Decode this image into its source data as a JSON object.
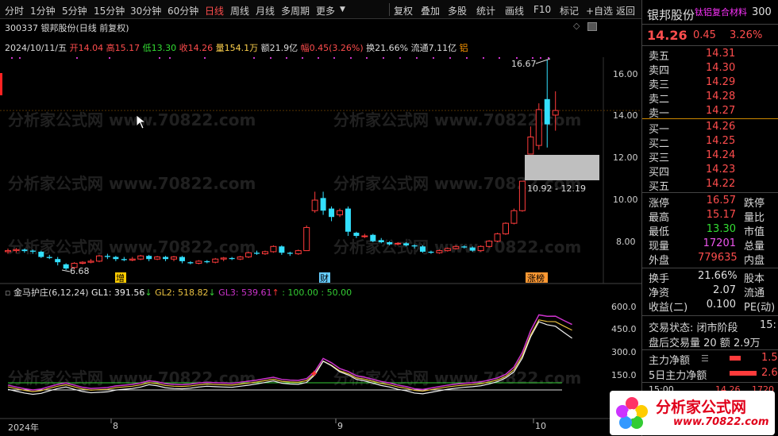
{
  "toolbar": {
    "periods": [
      "分时",
      "1分钟",
      "5分钟",
      "15分钟",
      "30分钟",
      "60分钟",
      "日线",
      "周线",
      "月线",
      "多周期",
      "更多"
    ],
    "active_period": "日线",
    "tools": [
      "复权",
      "叠加",
      "多股",
      "统计",
      "画线",
      "F10",
      "标记",
      "+自选",
      "返回"
    ]
  },
  "chart": {
    "title": "300337 银邦股份(日线 前复权)",
    "date": "2024/10/11/五",
    "quote": {
      "open_label": "开",
      "open": "14.04",
      "high_label": "高",
      "high": "15.17",
      "low_label": "低",
      "low": "13.30",
      "close_label": "收",
      "close": "14.26",
      "vol_label": "量",
      "vol": "154.1万",
      "amt_label": "额",
      "amt": "21.9亿",
      "chg_label": "幅",
      "chg": "0.45(3.26%)",
      "turn_label": "换",
      "turn": "21.66%",
      "float_label": "流通",
      "float": "7.11亿",
      "tag": "铝"
    },
    "price_axis": [
      "16.00",
      "14.00",
      "12.00",
      "10.00",
      "8.00"
    ],
    "annotations": {
      "high_mark": "16.67",
      "low_mark": "6.68",
      "gap_range": "10.92 - 12.19"
    },
    "event_tags": [
      "增",
      "财",
      "涨榜"
    ],
    "time_axis": [
      "2024年",
      "8",
      "9",
      "10"
    ]
  },
  "indicator": {
    "name": "金马护庄(6,12,24)",
    "gl1": "GL1: 391.56",
    "gl2": "GL2: 518.82",
    "gl3": "GL3: 539.61",
    "levels": ": 100.00  : 50.00",
    "axis": [
      "600.0",
      "450.0",
      "300.0",
      "150.0"
    ]
  },
  "panel": {
    "name": "银邦股份",
    "code": "300",
    "concept": "钛铝复合材料",
    "price": "14.26",
    "change": "0.45",
    "pct": "3.26%",
    "asks": [
      {
        "label": "卖五",
        "price": "14.31"
      },
      {
        "label": "卖四",
        "price": "14.30"
      },
      {
        "label": "卖三",
        "price": "14.29"
      },
      {
        "label": "卖二",
        "price": "14.28"
      },
      {
        "label": "卖一",
        "price": "14.27"
      }
    ],
    "bids": [
      {
        "label": "买一",
        "price": "14.26"
      },
      {
        "label": "买二",
        "price": "14.25"
      },
      {
        "label": "买三",
        "price": "14.24"
      },
      {
        "label": "买四",
        "price": "14.23"
      },
      {
        "label": "买五",
        "price": "14.22"
      }
    ],
    "stats": [
      {
        "l": "涨停",
        "v": "16.57",
        "c": "#ff4d4d",
        "r": "跌停"
      },
      {
        "l": "最高",
        "v": "15.17",
        "c": "#ff4d4d",
        "r": "量比"
      },
      {
        "l": "最低",
        "v": "13.30",
        "c": "#33dd33",
        "r": "市值"
      },
      {
        "l": "现量",
        "v": "17201",
        "c": "#ee55ee",
        "r": "总量"
      },
      {
        "l": "外盘",
        "v": "779635",
        "c": "#ff4d4d",
        "r": "内盘"
      }
    ],
    "stats2": [
      {
        "l": "换手",
        "v": "21.66%",
        "c": "#e0e0e0",
        "r": "股本"
      },
      {
        "l": "净资",
        "v": "2.07",
        "c": "#e0e0e0",
        "r": "流通"
      },
      {
        "l": "收益(二)",
        "v": "0.100",
        "c": "#e0e0e0",
        "r": "PE(动)"
      }
    ],
    "trade_state": "交易状态: 闭市阶段",
    "trade_state_tail": "15:",
    "after_hours": "盘后交易量 20 额 2.9万",
    "main_net": "主力净额",
    "main_net_val": "1.5",
    "main_net_5d": "5日主力净额",
    "main_net_5d_val": "2.6",
    "tick_time": "15:00",
    "tick_price": "14.26",
    "tick_vol": "1720"
  },
  "watermark": "分析家公式网 www.70822.com",
  "logo": {
    "name": "分析家公式网",
    "url": "www.70822.com"
  },
  "colors": {
    "up": "#ff3b3b",
    "down": "#33e0ff",
    "green": "#33dd33",
    "accent_orange": "#ff9900"
  }
}
